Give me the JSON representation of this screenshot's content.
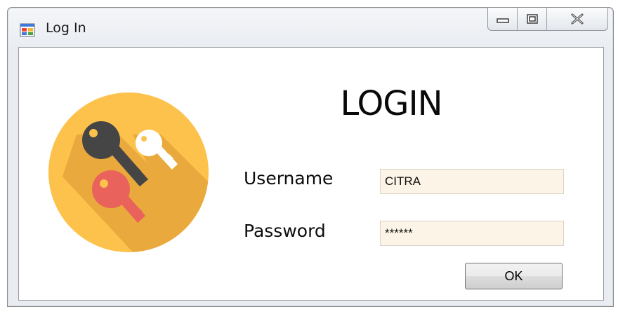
{
  "window": {
    "title": "Log In",
    "icon": "windows-form-icon",
    "caption_buttons": [
      "minimize-icon",
      "restore-icon",
      "close-icon"
    ]
  },
  "form": {
    "heading": "LOGIN",
    "username_label": "Username",
    "username_value": "CITRA",
    "password_label": "Password",
    "password_value": "******",
    "ok_label": "OK"
  },
  "logo": {
    "icon": "keys-icon",
    "colors": {
      "circle": "#fcc24c",
      "shadow": "#e9a93c",
      "dark_key": "#454545",
      "white_key": "#ffffff",
      "red_key": "#e9625b"
    }
  },
  "colors": {
    "textbox_background": "#fcf4e6",
    "titlebar": "#eef1f5"
  }
}
